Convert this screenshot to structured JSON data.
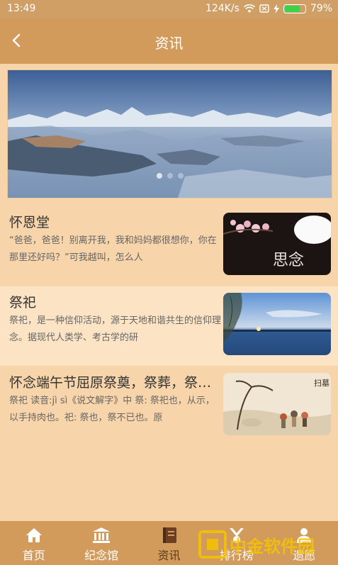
{
  "status": {
    "time": "13:49",
    "speed": "124K/s",
    "battery": "79%",
    "battery_level": 0.79
  },
  "appbar": {
    "title": "资讯"
  },
  "banner": {
    "slides": 3,
    "active": 0
  },
  "news": [
    {
      "title": "怀恩堂",
      "desc": "“爸爸，爸爸！别离开我，我和妈妈都很想你，你在那里还好吗？”可我越叫，怎么人"
    },
    {
      "title": "祭祀",
      "desc": "祭祀，是一种信仰活动，源于天地和谐共生的信仰理念。据现代人类学、考古学的研"
    },
    {
      "title": "怀念端午节屈原祭奠，祭葬，祭祀，",
      "desc": "祭祀 读音:jì sì《说文解字》中 祭: 祭祀也，从示，以手持肉也。祀: 祭也，祭不已也。原"
    }
  ],
  "thumb1_text": "思念",
  "thumb3_text": "扫墓",
  "tabs": [
    {
      "label": "首页",
      "icon": "home-icon"
    },
    {
      "label": "纪念馆",
      "icon": "memorial-hall-icon"
    },
    {
      "label": "资讯",
      "icon": "book-icon"
    },
    {
      "label": "排行榜",
      "icon": "ranking-icon"
    },
    {
      "label": "遗愿",
      "icon": "profile-icon"
    }
  ],
  "active_tab": 2,
  "watermark": "中金软件园"
}
